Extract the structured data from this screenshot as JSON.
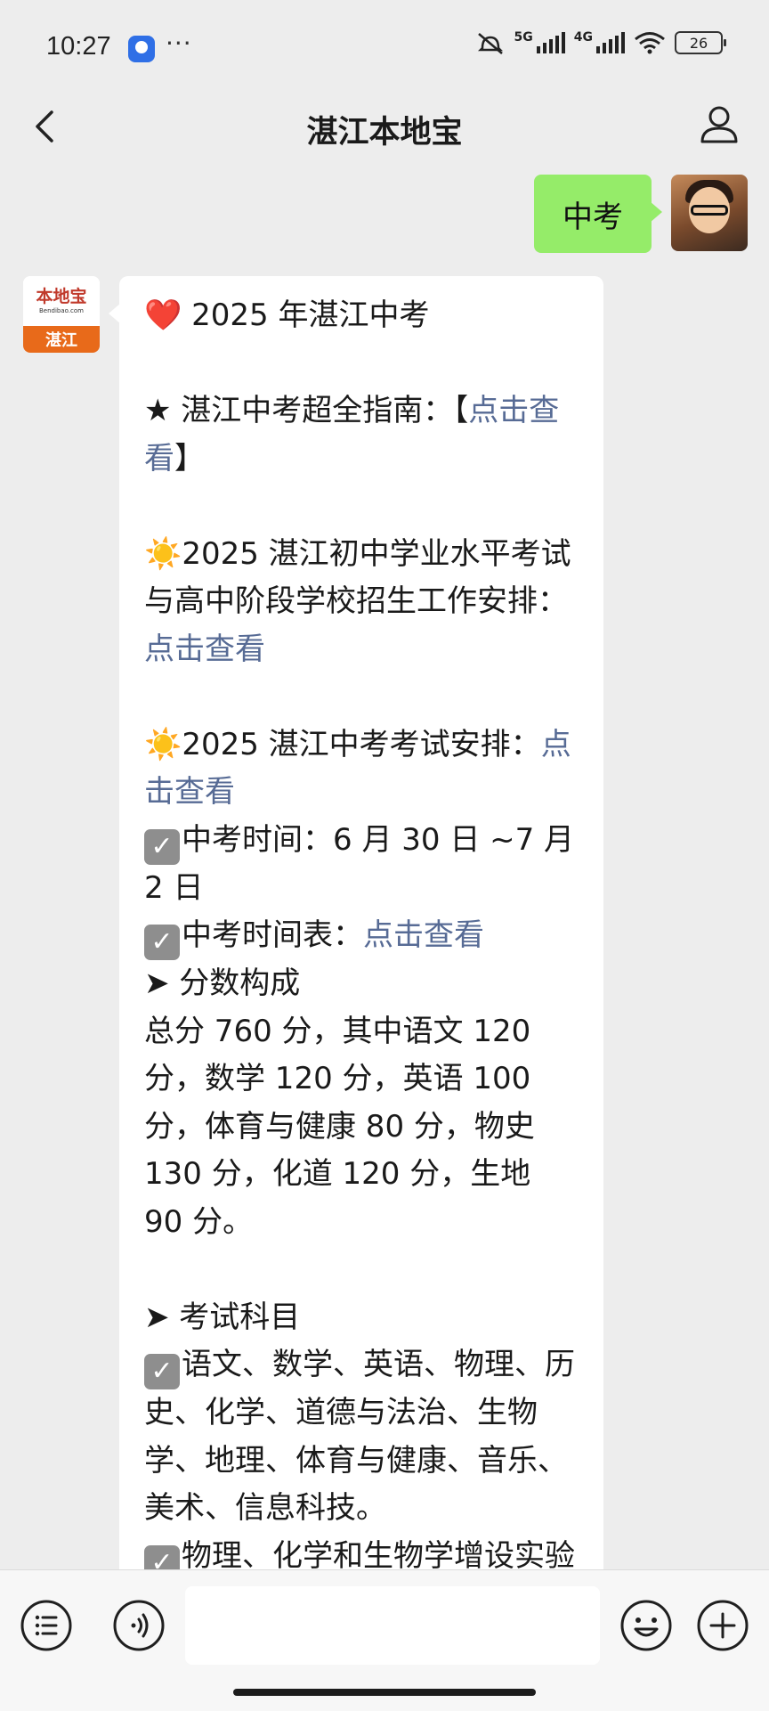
{
  "status_bar": {
    "time": "10:27",
    "dots": "···",
    "net1": "5G",
    "net2": "4G",
    "battery": "26"
  },
  "header": {
    "title": "湛江本地宝",
    "back_icon": "chevron-left-icon",
    "profile_icon": "user-icon"
  },
  "my_message": {
    "text": "中考"
  },
  "bot_avatar": {
    "brand": "本地宝",
    "url": "Bendibao.com",
    "city": "湛江"
  },
  "bot_message": {
    "title": " 2025 年湛江中考",
    "heart": "❤️",
    "guide_prefix": "★ 湛江中考超全指南：【",
    "guide_link": "点击查看",
    "guide_suffix": "】",
    "sun1": "☀️",
    "arrangement_text": "2025 湛江初中学业水平考试与高中阶段学校招生工作安排：",
    "arrangement_link": "点击查看",
    "sun2": "☀️",
    "exam_text": "2025 湛江中考考试安排：",
    "exam_link": "点击查看",
    "exam_time": "中考时间：6 月 30 日 ~7 月 2 日",
    "schedule_text": "中考时间表：",
    "schedule_link": "点击查看",
    "score_heading": "➤ 分数构成",
    "score_text": "总分 760 分，其中语文 120 分，数学 120 分，英语 100 分，体育与健康 80 分，物史 130 分，化道 120 分，生地 90 分。",
    "subjects_heading": "➤ 考试科目",
    "subjects_text": "语文、数学、英语、物理、历史、化学、道德与法治、生物学、地理、体育与健康、音乐、美术、信息科技。",
    "lab_text": "物理、化学和生物学增设实验操作考试"
  },
  "input_bar": {
    "menu_icon": "list-icon",
    "voice_icon": "voice-icon",
    "emoji_icon": "emoji-icon",
    "add_icon": "plus-icon",
    "input_value": ""
  },
  "colors": {
    "background": "#ededed",
    "my_bubble": "#95ec69",
    "link": "#576b95"
  }
}
